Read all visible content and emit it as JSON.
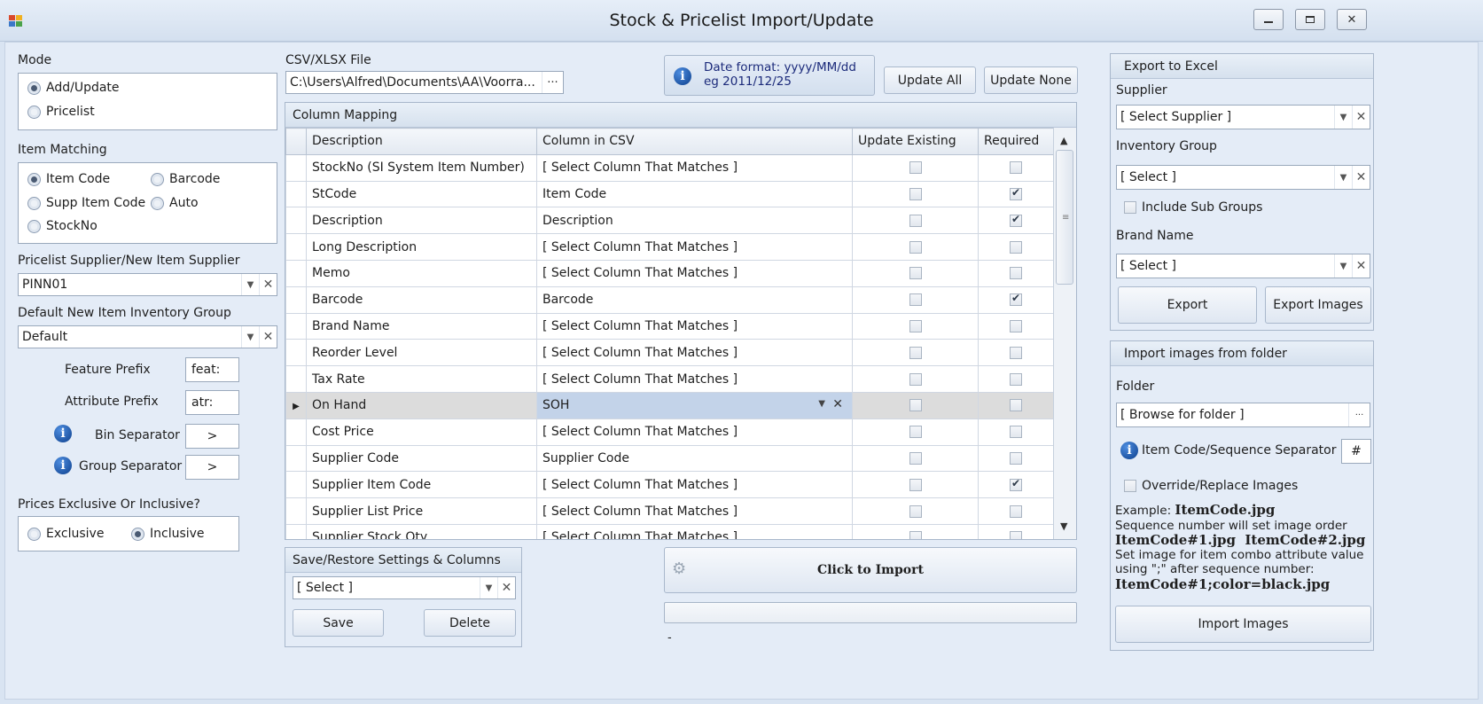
{
  "window": {
    "title": "Stock & Pricelist Import/Update"
  },
  "mode": {
    "label": "Mode",
    "options": [
      "Add/Update",
      "Pricelist"
    ],
    "selected": 0
  },
  "item_matching": {
    "label": "Item Matching",
    "options": [
      "Item Code",
      "Barcode",
      "Supp Item Code",
      "Auto",
      "StockNo"
    ],
    "selected": 0
  },
  "pricelist_supplier": {
    "label": "Pricelist Supplier/New Item Supplier",
    "value": "PINN01"
  },
  "default_group": {
    "label": "Default New Item Inventory Group",
    "value": "Default"
  },
  "feature_prefix": {
    "label": "Feature Prefix",
    "value": "feat:"
  },
  "attribute_prefix": {
    "label": "Attribute Prefix",
    "value": "atr:"
  },
  "bin_separator": {
    "label": "Bin Separator",
    "value": ">"
  },
  "group_separator": {
    "label": "Group Separator",
    "value": ">"
  },
  "prices": {
    "label": "Prices Exclusive Or Inclusive?",
    "options": [
      "Exclusive",
      "Inclusive"
    ],
    "selected": 1
  },
  "csv": {
    "label": "CSV/XLSX File",
    "path": "C:\\Users\\Alfred\\Documents\\AA\\Voorra...",
    "browse_label": "···"
  },
  "date_info": {
    "line1": "Date format: yyyy/MM/dd",
    "line2": "eg 2011/12/25"
  },
  "update_all_label": "Update All",
  "update_none_label": "Update None",
  "column_mapping": {
    "title": "Column Mapping",
    "headers": [
      "Description",
      "Column in CSV",
      "Update Existing",
      "Required"
    ],
    "rows": [
      {
        "desc": "StockNo (SI System Item Number)",
        "csv": "[ Select Column That Matches ]",
        "update": false,
        "required": false
      },
      {
        "desc": "StCode",
        "csv": "Item Code",
        "update": false,
        "required": true
      },
      {
        "desc": "Description",
        "csv": "Description",
        "update": false,
        "required": true
      },
      {
        "desc": "Long Description",
        "csv": "[ Select Column That Matches ]",
        "update": false,
        "required": false
      },
      {
        "desc": "Memo",
        "csv": "[ Select Column That Matches ]",
        "update": false,
        "required": false
      },
      {
        "desc": "Barcode",
        "csv": "Barcode",
        "update": false,
        "required": true
      },
      {
        "desc": "Brand Name",
        "csv": "[ Select Column That Matches ]",
        "update": false,
        "required": false
      },
      {
        "desc": "Reorder Level",
        "csv": "[ Select Column That Matches ]",
        "update": false,
        "required": false
      },
      {
        "desc": "Tax Rate",
        "csv": "[ Select Column That Matches ]",
        "update": false,
        "required": false
      },
      {
        "desc": "On Hand",
        "csv": "SOH",
        "update": false,
        "required": false
      },
      {
        "desc": "Cost Price",
        "csv": "[ Select Column That Matches ]",
        "update": false,
        "required": false
      },
      {
        "desc": "Supplier Code",
        "csv": "Supplier Code",
        "update": false,
        "required": false
      },
      {
        "desc": "Supplier Item Code",
        "csv": "[ Select Column That Matches ]",
        "update": false,
        "required": true
      },
      {
        "desc": "Supplier List Price",
        "csv": "[ Select Column That Matches ]",
        "update": false,
        "required": false
      },
      {
        "desc": "Supplier Stock Qty",
        "csv": "[ Select Column That Matches ]",
        "update": false,
        "required": false
      }
    ],
    "selected_row": 9
  },
  "save_restore": {
    "title": "Save/Restore Settings & Columns",
    "select_value": "[ Select ]",
    "save_label": "Save",
    "delete_label": "Delete"
  },
  "import": {
    "label": "Click to Import",
    "progress": 0,
    "status": "-"
  },
  "export": {
    "title": "Export to Excel",
    "supplier_label": "Supplier",
    "supplier_value": "[ Select Supplier ]",
    "group_label": "Inventory Group",
    "group_value": "[ Select ]",
    "include_sub_label": "Include Sub Groups",
    "brand_label": "Brand Name",
    "brand_value": "[ Select ]",
    "export_label": "Export",
    "export_images_label": "Export Images"
  },
  "images": {
    "title": "Import images from folder",
    "folder_label": "Folder",
    "folder_value": "[ Browse for folder ]",
    "browse_label": "···",
    "separator_label": "Item Code/Sequence Separator",
    "separator_value": "#",
    "override_label": "Override/Replace Images",
    "example_prefix": "Example: ",
    "example_file": "ItemCode.jpg",
    "seq_text": "Sequence number will set image order",
    "seq_files": "ItemCode#1.jpg  ItemCode#2.jpg",
    "combo_text1": "Set image for item combo attribute value",
    "combo_text2": "using \";\" after sequence number:",
    "combo_file": "ItemCode#1;color=black.jpg",
    "import_label": "Import Images"
  }
}
